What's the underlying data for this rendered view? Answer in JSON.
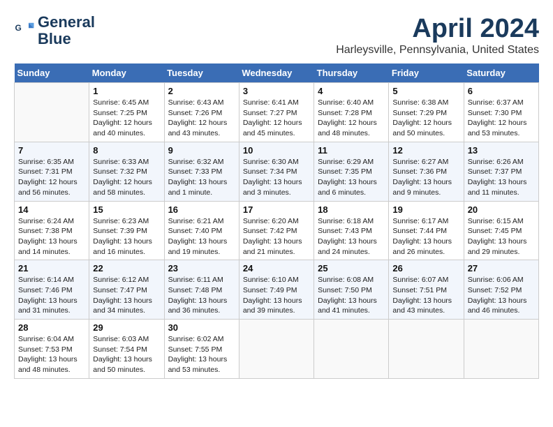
{
  "header": {
    "logo_line1": "General",
    "logo_line2": "Blue",
    "month": "April 2024",
    "location": "Harleysville, Pennsylvania, United States"
  },
  "weekdays": [
    "Sunday",
    "Monday",
    "Tuesday",
    "Wednesday",
    "Thursday",
    "Friday",
    "Saturday"
  ],
  "weeks": [
    [
      {
        "num": "",
        "empty": true
      },
      {
        "num": "1",
        "sunrise": "Sunrise: 6:45 AM",
        "sunset": "Sunset: 7:25 PM",
        "daylight": "Daylight: 12 hours and 40 minutes."
      },
      {
        "num": "2",
        "sunrise": "Sunrise: 6:43 AM",
        "sunset": "Sunset: 7:26 PM",
        "daylight": "Daylight: 12 hours and 43 minutes."
      },
      {
        "num": "3",
        "sunrise": "Sunrise: 6:41 AM",
        "sunset": "Sunset: 7:27 PM",
        "daylight": "Daylight: 12 hours and 45 minutes."
      },
      {
        "num": "4",
        "sunrise": "Sunrise: 6:40 AM",
        "sunset": "Sunset: 7:28 PM",
        "daylight": "Daylight: 12 hours and 48 minutes."
      },
      {
        "num": "5",
        "sunrise": "Sunrise: 6:38 AM",
        "sunset": "Sunset: 7:29 PM",
        "daylight": "Daylight: 12 hours and 50 minutes."
      },
      {
        "num": "6",
        "sunrise": "Sunrise: 6:37 AM",
        "sunset": "Sunset: 7:30 PM",
        "daylight": "Daylight: 12 hours and 53 minutes."
      }
    ],
    [
      {
        "num": "7",
        "sunrise": "Sunrise: 6:35 AM",
        "sunset": "Sunset: 7:31 PM",
        "daylight": "Daylight: 12 hours and 56 minutes."
      },
      {
        "num": "8",
        "sunrise": "Sunrise: 6:33 AM",
        "sunset": "Sunset: 7:32 PM",
        "daylight": "Daylight: 12 hours and 58 minutes."
      },
      {
        "num": "9",
        "sunrise": "Sunrise: 6:32 AM",
        "sunset": "Sunset: 7:33 PM",
        "daylight": "Daylight: 13 hours and 1 minute."
      },
      {
        "num": "10",
        "sunrise": "Sunrise: 6:30 AM",
        "sunset": "Sunset: 7:34 PM",
        "daylight": "Daylight: 13 hours and 3 minutes."
      },
      {
        "num": "11",
        "sunrise": "Sunrise: 6:29 AM",
        "sunset": "Sunset: 7:35 PM",
        "daylight": "Daylight: 13 hours and 6 minutes."
      },
      {
        "num": "12",
        "sunrise": "Sunrise: 6:27 AM",
        "sunset": "Sunset: 7:36 PM",
        "daylight": "Daylight: 13 hours and 9 minutes."
      },
      {
        "num": "13",
        "sunrise": "Sunrise: 6:26 AM",
        "sunset": "Sunset: 7:37 PM",
        "daylight": "Daylight: 13 hours and 11 minutes."
      }
    ],
    [
      {
        "num": "14",
        "sunrise": "Sunrise: 6:24 AM",
        "sunset": "Sunset: 7:38 PM",
        "daylight": "Daylight: 13 hours and 14 minutes."
      },
      {
        "num": "15",
        "sunrise": "Sunrise: 6:23 AM",
        "sunset": "Sunset: 7:39 PM",
        "daylight": "Daylight: 13 hours and 16 minutes."
      },
      {
        "num": "16",
        "sunrise": "Sunrise: 6:21 AM",
        "sunset": "Sunset: 7:40 PM",
        "daylight": "Daylight: 13 hours and 19 minutes."
      },
      {
        "num": "17",
        "sunrise": "Sunrise: 6:20 AM",
        "sunset": "Sunset: 7:42 PM",
        "daylight": "Daylight: 13 hours and 21 minutes."
      },
      {
        "num": "18",
        "sunrise": "Sunrise: 6:18 AM",
        "sunset": "Sunset: 7:43 PM",
        "daylight": "Daylight: 13 hours and 24 minutes."
      },
      {
        "num": "19",
        "sunrise": "Sunrise: 6:17 AM",
        "sunset": "Sunset: 7:44 PM",
        "daylight": "Daylight: 13 hours and 26 minutes."
      },
      {
        "num": "20",
        "sunrise": "Sunrise: 6:15 AM",
        "sunset": "Sunset: 7:45 PM",
        "daylight": "Daylight: 13 hours and 29 minutes."
      }
    ],
    [
      {
        "num": "21",
        "sunrise": "Sunrise: 6:14 AM",
        "sunset": "Sunset: 7:46 PM",
        "daylight": "Daylight: 13 hours and 31 minutes."
      },
      {
        "num": "22",
        "sunrise": "Sunrise: 6:12 AM",
        "sunset": "Sunset: 7:47 PM",
        "daylight": "Daylight: 13 hours and 34 minutes."
      },
      {
        "num": "23",
        "sunrise": "Sunrise: 6:11 AM",
        "sunset": "Sunset: 7:48 PM",
        "daylight": "Daylight: 13 hours and 36 minutes."
      },
      {
        "num": "24",
        "sunrise": "Sunrise: 6:10 AM",
        "sunset": "Sunset: 7:49 PM",
        "daylight": "Daylight: 13 hours and 39 minutes."
      },
      {
        "num": "25",
        "sunrise": "Sunrise: 6:08 AM",
        "sunset": "Sunset: 7:50 PM",
        "daylight": "Daylight: 13 hours and 41 minutes."
      },
      {
        "num": "26",
        "sunrise": "Sunrise: 6:07 AM",
        "sunset": "Sunset: 7:51 PM",
        "daylight": "Daylight: 13 hours and 43 minutes."
      },
      {
        "num": "27",
        "sunrise": "Sunrise: 6:06 AM",
        "sunset": "Sunset: 7:52 PM",
        "daylight": "Daylight: 13 hours and 46 minutes."
      }
    ],
    [
      {
        "num": "28",
        "sunrise": "Sunrise: 6:04 AM",
        "sunset": "Sunset: 7:53 PM",
        "daylight": "Daylight: 13 hours and 48 minutes."
      },
      {
        "num": "29",
        "sunrise": "Sunrise: 6:03 AM",
        "sunset": "Sunset: 7:54 PM",
        "daylight": "Daylight: 13 hours and 50 minutes."
      },
      {
        "num": "30",
        "sunrise": "Sunrise: 6:02 AM",
        "sunset": "Sunset: 7:55 PM",
        "daylight": "Daylight: 13 hours and 53 minutes."
      },
      {
        "num": "",
        "empty": true
      },
      {
        "num": "",
        "empty": true
      },
      {
        "num": "",
        "empty": true
      },
      {
        "num": "",
        "empty": true
      }
    ]
  ]
}
